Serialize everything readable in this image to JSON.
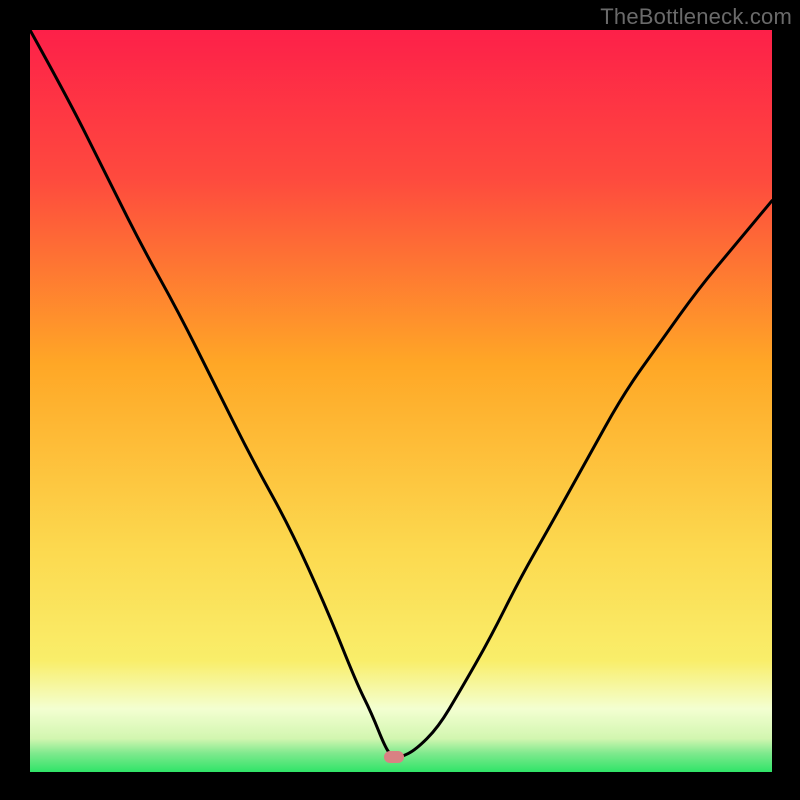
{
  "watermark": "TheBottleneck.com",
  "colors": {
    "frame_bg": "#000000",
    "watermark": "#6a6a6a",
    "curve": "#000000",
    "marker": "#d98183",
    "gradient_top": "#fd2049",
    "gradient_mid": "#ffa726",
    "gradient_lower": "#f9ee6a",
    "gradient_band": "#f3ffd1",
    "gradient_bottom": "#30e468"
  },
  "chart_data": {
    "type": "line",
    "title": "",
    "xlabel": "",
    "ylabel": "",
    "xlim": [
      0,
      100
    ],
    "ylim": [
      0,
      100
    ],
    "grid": false,
    "legend": false,
    "annotations": [
      "TheBottleneck.com"
    ],
    "marker": {
      "x": 49,
      "y": 2
    },
    "series": [
      {
        "name": "curve",
        "x": [
          0,
          5,
          10,
          15,
          20,
          25,
          30,
          35,
          40,
          44,
          46,
          48,
          49,
          50,
          52,
          55,
          58,
          62,
          66,
          70,
          75,
          80,
          85,
          90,
          95,
          100
        ],
        "y": [
          100,
          91,
          81,
          71,
          62,
          52,
          42,
          33,
          22,
          12,
          8,
          3,
          2,
          2,
          3,
          6,
          11,
          18,
          26,
          33,
          42,
          51,
          58,
          65,
          71,
          77
        ]
      }
    ],
    "background_gradient": {
      "direction": "vertical",
      "stops": [
        {
          "pos": 0.0,
          "color": "#fd2049"
        },
        {
          "pos": 0.2,
          "color": "#fe4a3e"
        },
        {
          "pos": 0.45,
          "color": "#ffa726"
        },
        {
          "pos": 0.7,
          "color": "#fcd94f"
        },
        {
          "pos": 0.85,
          "color": "#f9ee6a"
        },
        {
          "pos": 0.915,
          "color": "#f3ffd1"
        },
        {
          "pos": 0.955,
          "color": "#d2f6b0"
        },
        {
          "pos": 0.975,
          "color": "#7ee98d"
        },
        {
          "pos": 1.0,
          "color": "#30e468"
        }
      ]
    }
  }
}
